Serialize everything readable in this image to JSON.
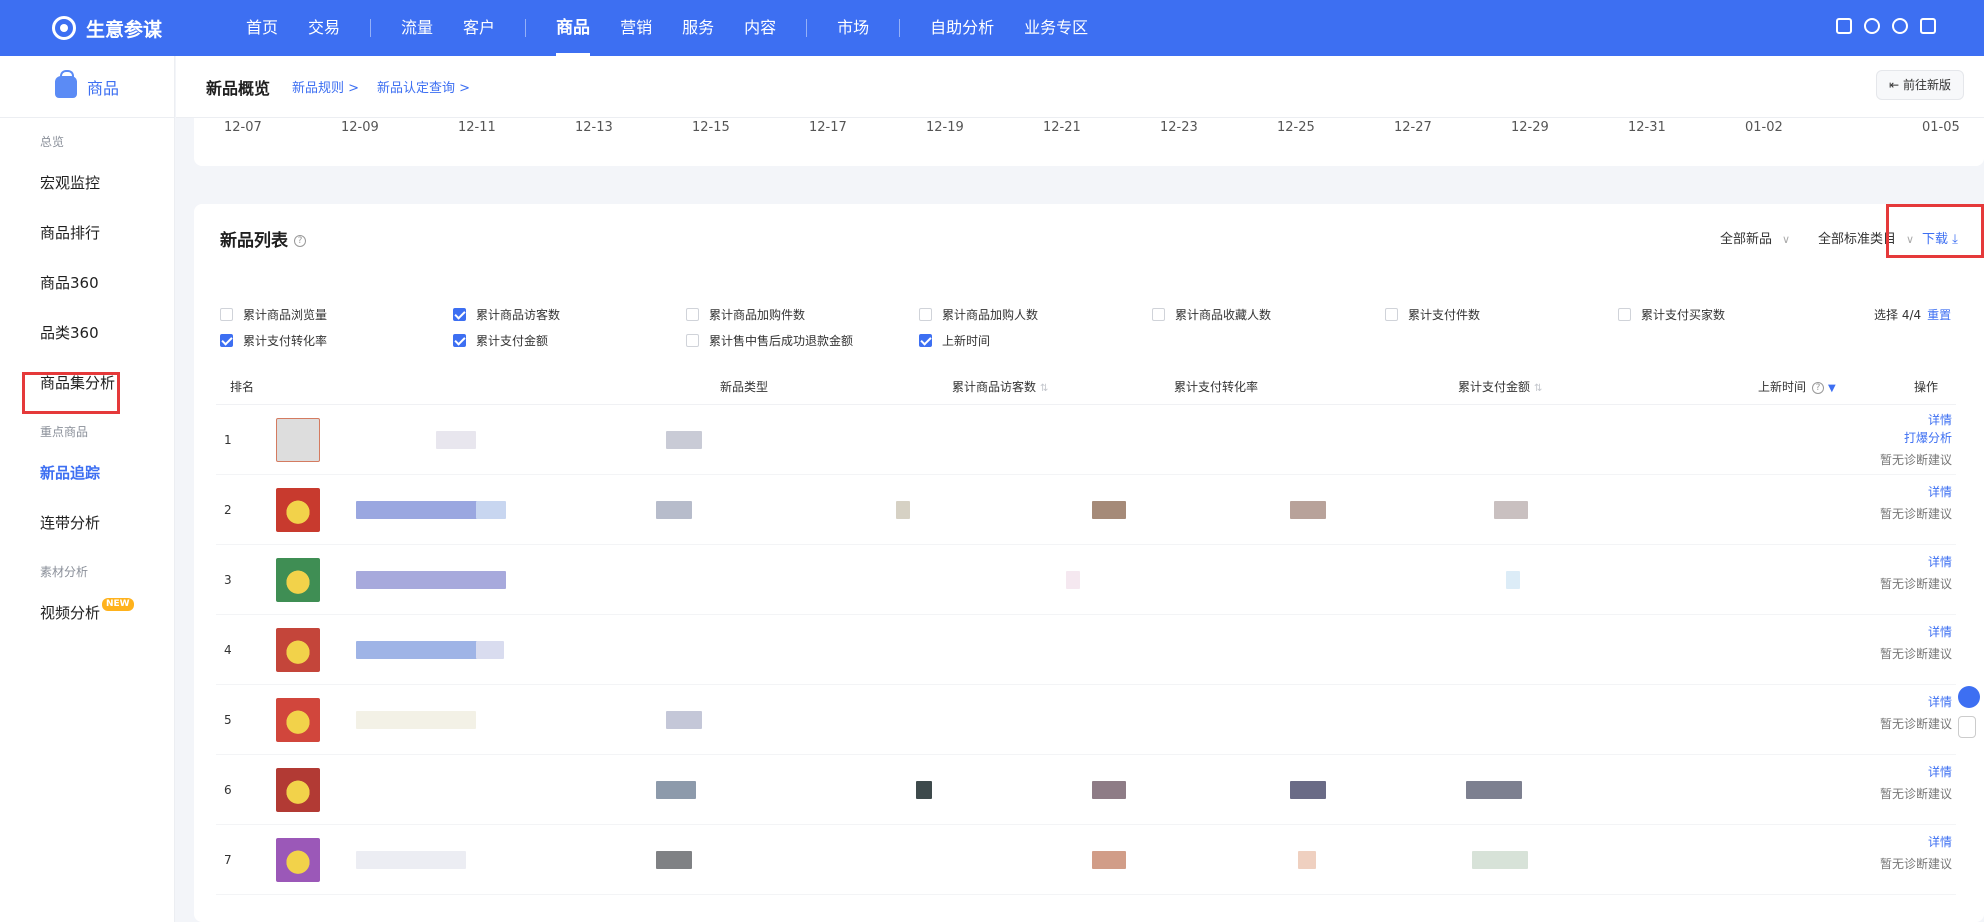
{
  "app": {
    "name": "生意参谋"
  },
  "nav": {
    "items": [
      {
        "label": "首页",
        "active": false
      },
      {
        "label": "交易",
        "active": false
      },
      {
        "label": "|",
        "sep": true
      },
      {
        "label": "流量",
        "active": false
      },
      {
        "label": "客户",
        "active": false
      },
      {
        "label": "|",
        "sep": true
      },
      {
        "label": "商品",
        "active": true
      },
      {
        "label": "营销",
        "active": false
      },
      {
        "label": "服务",
        "active": false
      },
      {
        "label": "内容",
        "active": false
      },
      {
        "label": "|",
        "sep": true
      },
      {
        "label": "市场",
        "active": false
      },
      {
        "label": "|",
        "sep": true
      },
      {
        "label": "自助分析",
        "active": false
      },
      {
        "label": "业务专区",
        "active": false
      }
    ]
  },
  "sidebar": {
    "section_title": "商品",
    "groups": [
      {
        "title": "总览",
        "items": [
          "宏观监控",
          "商品排行",
          "商品360",
          "品类360",
          "商品集分析"
        ]
      },
      {
        "title": "重点商品",
        "items": [
          "新品追踪",
          "连带分析"
        ]
      },
      {
        "title": "素材分析",
        "items": [
          "视频分析"
        ]
      }
    ],
    "active_item": "新品追踪",
    "new_badge": "NEW"
  },
  "subheader": {
    "title": "新品概览",
    "crumbs": [
      "新品规则 >",
      "新品认定查询 >"
    ],
    "go_new_button": "⇤ 前往新版"
  },
  "axis_dates": [
    "12-07",
    "12-09",
    "12-11",
    "12-13",
    "12-15",
    "12-17",
    "12-19",
    "12-21",
    "12-23",
    "12-25",
    "12-27",
    "12-29",
    "12-31",
    "01-02",
    "01-05"
  ],
  "list": {
    "title": "新品列表",
    "filter_all_new": "全部新品",
    "filter_category": "全部标准类目",
    "download": "下载 ⤓",
    "pick_count": "选择 4/4",
    "reset": "重置",
    "metrics": [
      {
        "label": "累计商品浏览量",
        "checked": false
      },
      {
        "label": "累计商品访客数",
        "checked": true
      },
      {
        "label": "累计商品加购件数",
        "checked": false
      },
      {
        "label": "累计商品加购人数",
        "checked": false
      },
      {
        "label": "累计商品收藏人数",
        "checked": false
      },
      {
        "label": "累计支付件数",
        "checked": false
      },
      {
        "label": "累计支付买家数",
        "checked": false
      },
      {
        "label": "累计支付转化率",
        "checked": true
      },
      {
        "label": "累计支付金额",
        "checked": true
      },
      {
        "label": "累计售中售后成功退款金额",
        "checked": false
      },
      {
        "label": "上新时间",
        "checked": true
      }
    ],
    "columns": [
      "排名",
      "新品类型",
      "累计商品访客数",
      "累计支付转化率",
      "累计支付金额",
      "上新时间",
      "操作"
    ],
    "actions": {
      "detail": "详情",
      "analysis": "打爆分析",
      "no_advice": "暂无诊断建议"
    },
    "rows": [
      {
        "rank": "1",
        "has_analysis": true
      },
      {
        "rank": "2",
        "has_analysis": false
      },
      {
        "rank": "3",
        "has_analysis": false
      },
      {
        "rank": "4",
        "has_analysis": false
      },
      {
        "rank": "5",
        "has_analysis": false
      },
      {
        "rank": "6",
        "has_analysis": false
      },
      {
        "rank": "7",
        "has_analysis": false
      }
    ]
  },
  "colors": {
    "brand": "#3d6ff2",
    "highlight_box": "#e5393a"
  }
}
